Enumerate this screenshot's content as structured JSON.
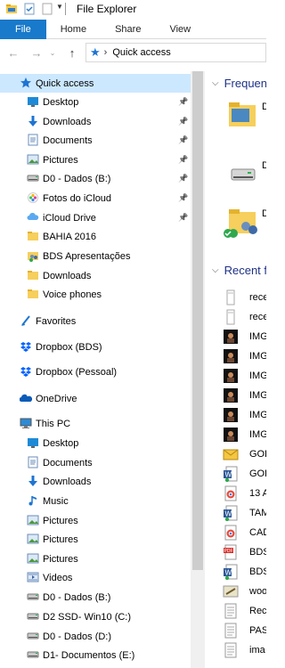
{
  "window": {
    "title": "File Explorer"
  },
  "ribbon": {
    "tabs": [
      "File",
      "Home",
      "Share",
      "View"
    ]
  },
  "address": {
    "location": "Quick access"
  },
  "nav": {
    "items": [
      {
        "label": "Quick access",
        "icon": "star-icon",
        "pinned": false
      },
      {
        "label": "Desktop",
        "icon": "desktop-folder-icon",
        "pinned": true
      },
      {
        "label": "Downloads",
        "icon": "download-arrow-icon",
        "pinned": true
      },
      {
        "label": "Documents",
        "icon": "documents-folder-icon",
        "pinned": true
      },
      {
        "label": "Pictures",
        "icon": "pictures-folder-icon",
        "pinned": true
      },
      {
        "label": "D0 - Dados (B:)",
        "icon": "drive-icon",
        "pinned": true
      },
      {
        "label": "Fotos do iCloud",
        "icon": "icloud-photos-icon",
        "pinned": true
      },
      {
        "label": "iCloud Drive",
        "icon": "icloud-drive-icon",
        "pinned": true
      },
      {
        "label": "BAHIA 2016",
        "icon": "folder-icon",
        "pinned": false
      },
      {
        "label": "BDS Apresentações",
        "icon": "shared-folder-icon",
        "pinned": false
      },
      {
        "label": "Downloads",
        "icon": "folder-icon",
        "pinned": false
      },
      {
        "label": "Voice phones",
        "icon": "folder-icon",
        "pinned": false
      },
      {
        "label": "Favorites",
        "icon": "favorites-icon",
        "pinned": false
      },
      {
        "label": "Dropbox (BDS)",
        "icon": "dropbox-icon",
        "pinned": false
      },
      {
        "label": "Dropbox (Pessoal)",
        "icon": "dropbox-icon",
        "pinned": false
      },
      {
        "label": "OneDrive",
        "icon": "onedrive-icon",
        "pinned": false
      },
      {
        "label": "This PC",
        "icon": "computer-icon",
        "pinned": false
      },
      {
        "label": "Desktop",
        "icon": "desktop-folder-icon",
        "pinned": false
      },
      {
        "label": "Documents",
        "icon": "documents-folder-icon",
        "pinned": false
      },
      {
        "label": "Downloads",
        "icon": "download-arrow-icon",
        "pinned": false
      },
      {
        "label": "Music",
        "icon": "music-icon",
        "pinned": false
      },
      {
        "label": "Pictures",
        "icon": "pictures-folder-icon",
        "pinned": false
      },
      {
        "label": "Pictures",
        "icon": "pictures-folder-icon",
        "pinned": false
      },
      {
        "label": "Pictures",
        "icon": "pictures-folder-icon",
        "pinned": false
      },
      {
        "label": "Videos",
        "icon": "videos-folder-icon",
        "pinned": false
      },
      {
        "label": "D0 - Dados (B:)",
        "icon": "drive-icon",
        "pinned": false
      },
      {
        "label": "D2 SSD- Win10 (C:)",
        "icon": "drive-icon",
        "pinned": false
      },
      {
        "label": "D0 - Dados (D:)",
        "icon": "drive-icon",
        "pinned": false
      },
      {
        "label": "D1- Documentos (E:)",
        "icon": "drive-icon",
        "pinned": false
      }
    ]
  },
  "content": {
    "frequent": {
      "heading": "Frequen",
      "items": [
        {
          "label": "D",
          "icon": "folder-icon"
        },
        {
          "label": "D",
          "icon": "drive-icon"
        },
        {
          "label": "D",
          "icon": "shared-folder-icon"
        }
      ]
    },
    "recent": {
      "heading": "Recent f",
      "items": [
        {
          "label": "rece",
          "icon": "phone-file-icon"
        },
        {
          "label": "rece",
          "icon": "phone-file-icon"
        },
        {
          "label": "IMG",
          "icon": "image-icon"
        },
        {
          "label": "IMG",
          "icon": "image-icon"
        },
        {
          "label": "IMG",
          "icon": "image-icon"
        },
        {
          "label": "IMG",
          "icon": "image-icon"
        },
        {
          "label": "IMG",
          "icon": "image-icon"
        },
        {
          "label": "IMG",
          "icon": "image-icon"
        },
        {
          "label": "GOL",
          "icon": "mail-icon"
        },
        {
          "label": "GOL",
          "icon": "word-icon"
        },
        {
          "label": "13 A",
          "icon": "chrome-doc-icon"
        },
        {
          "label": "TAM",
          "icon": "word-icon"
        },
        {
          "label": "CAD",
          "icon": "chrome-doc-icon"
        },
        {
          "label": "BDS",
          "icon": "pdf-icon"
        },
        {
          "label": "BDS",
          "icon": "word-icon"
        },
        {
          "label": "woo",
          "icon": "tool-icon"
        },
        {
          "label": "Rece",
          "icon": "text-file-icon"
        },
        {
          "label": "PASS",
          "icon": "text-file-icon"
        },
        {
          "label": "ima",
          "icon": "text-file-icon"
        }
      ]
    }
  }
}
